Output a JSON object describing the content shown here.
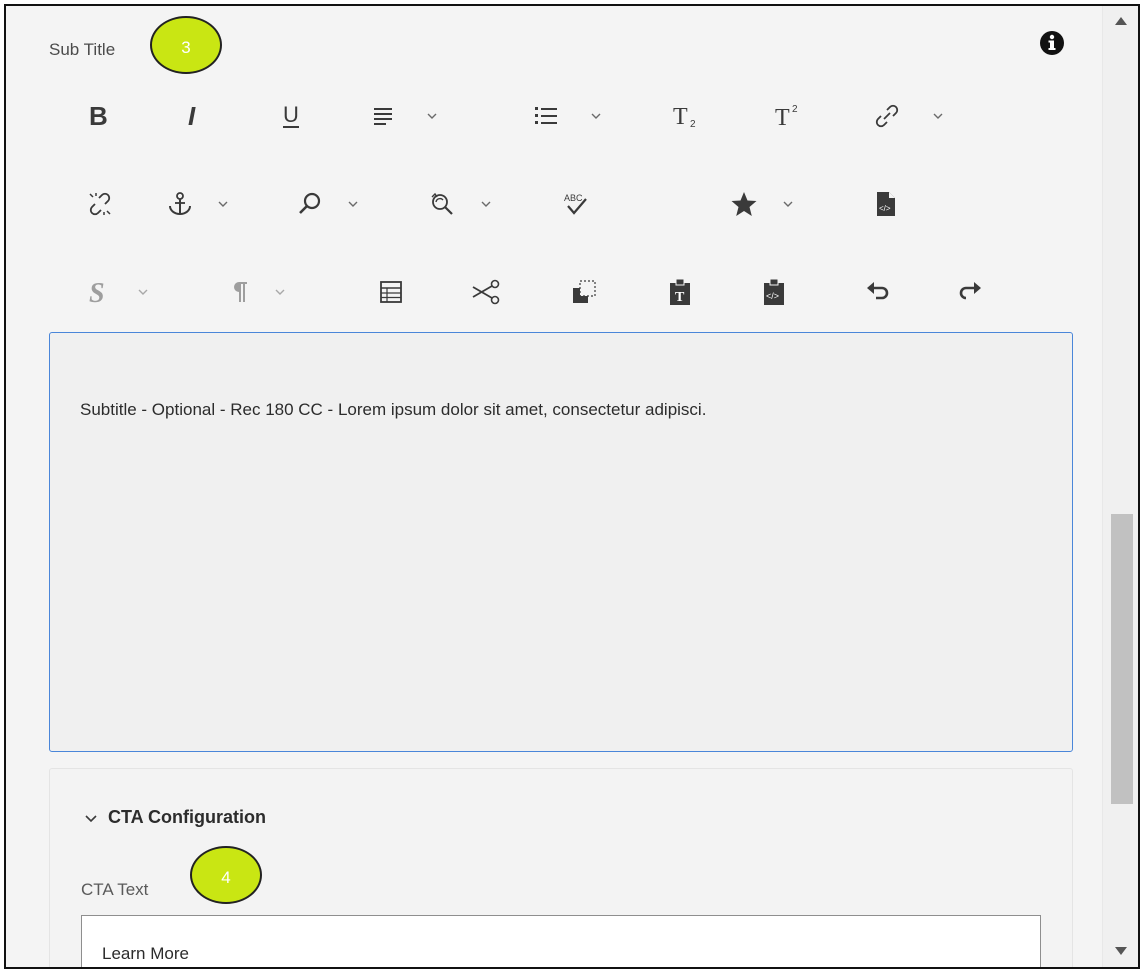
{
  "field": {
    "label": "Sub Title",
    "info_icon": "info-circle-icon"
  },
  "badges": {
    "subtitle_badge": "3",
    "cta_badge": "4"
  },
  "toolbar": {
    "row1": [
      "bold-icon",
      "italic-icon",
      "underline-icon",
      "align-icon",
      "list-icon",
      "subscript-icon",
      "superscript-icon",
      "link-icon"
    ],
    "row2": [
      "unlink-icon",
      "anchor-icon",
      "find-icon",
      "find-replace-icon",
      "spellcheck-icon",
      "special-char-icon",
      "source-edit-icon"
    ],
    "row3": [
      "styles-icon",
      "paragraph-format-icon",
      "table-icon",
      "cut-icon",
      "copy-icon",
      "paste-text-icon",
      "paste-html-icon",
      "undo-icon",
      "redo-icon"
    ]
  },
  "editor": {
    "content": "Subtitle - Optional - Rec 180 CC - Lorem ipsum dolor sit amet, consectetur adipisci."
  },
  "cta": {
    "section_title": "CTA Configuration",
    "text_label": "CTA Text",
    "text_value": "Learn More"
  },
  "colors": {
    "badge": "#c9e613",
    "editor_border": "#4a86d9",
    "icon_dark": "#3a3a3a",
    "icon_disabled": "#9e9e9e"
  }
}
